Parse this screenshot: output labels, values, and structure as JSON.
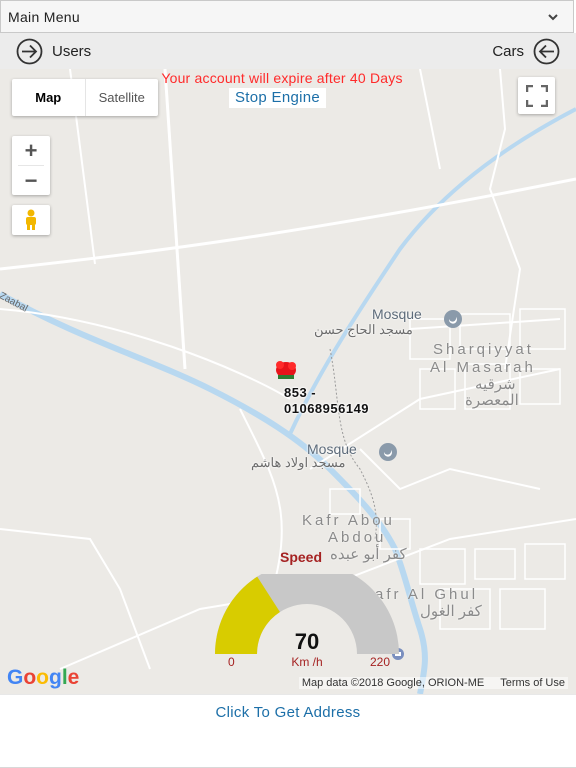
{
  "menu": {
    "title": "Main Menu"
  },
  "nav": {
    "left_label": "Users",
    "right_label": "Cars"
  },
  "map": {
    "expire_text": "Your account will expire after 40 Days",
    "map_type": {
      "map": "Map",
      "satellite": "Satellite"
    },
    "stop_engine": "Stop Engine",
    "zoom_in": "+",
    "zoom_out": "−",
    "places": {
      "mosque1_en": "Mosque",
      "mosque1_ar": "مسجد الحاج حسن",
      "mosque2_en": "Mosque",
      "mosque2_ar": "مسجد اولاد هاشم",
      "sharqiyyat_en1": "Sharqiyyat",
      "sharqiyyat_en2": "Al Masarah",
      "sharqiyyat_ar1": "شرقيه",
      "sharqiyyat_ar2": "المعصرة",
      "kafr_abou_en1": "Kafr Abou",
      "kafr_abou_en2": "Abdou",
      "kafr_abou_ar": "كفر أبو عبده",
      "kafr_ghul_en": "Kafr Al Ghul",
      "kafr_ghul_ar": "كفر الغول",
      "road_zaabal": "Zaabal"
    },
    "car": {
      "line1": "853 -",
      "line2": "01068956149"
    },
    "speed": {
      "title": "Speed",
      "value": "70",
      "unit": "Km /h",
      "min": "0",
      "max": "220",
      "fraction": 0.318
    },
    "google": "Google",
    "attribution": "Map data ©2018 Google, ORION-ME",
    "terms": "Terms of Use"
  },
  "address": {
    "label": "Click To Get Address"
  },
  "colors": {
    "gauge_fill": "#d8cc00",
    "gauge_track": "#c8c8c8",
    "link": "#1c6fa8",
    "warning": "#ff2a2a",
    "water": "#b8d8f0"
  }
}
